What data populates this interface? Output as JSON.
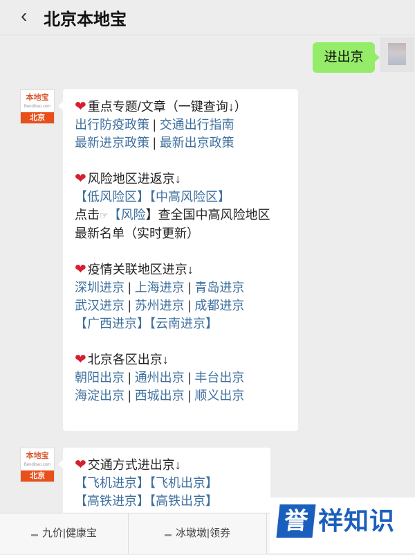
{
  "header": {
    "back_icon": "chevron-left-icon",
    "title": "北京本地宝"
  },
  "outgoing": {
    "text": "进出京"
  },
  "bot": {
    "logo_top": "本地宝",
    "logo_sub": "Bendibao.com",
    "logo_city": "北京"
  },
  "message1": {
    "section1_title": "重点专题/文章（一键查询↓）",
    "section1_row1": [
      "出行防疫政策",
      " | ",
      "交通出行指南"
    ],
    "section1_row2": [
      "最新进京政策",
      " | ",
      "最新出京政策"
    ],
    "section2_title": "风险地区进返京↓",
    "section2_row1": [
      "【",
      "低风险区",
      "】【",
      "中高风险区",
      "】"
    ],
    "section2_row2": [
      "点击",
      "☞",
      "【",
      "风险",
      "】查全国中高风险地区"
    ],
    "section2_row3": "最新名单（实时更新）",
    "section3_title": "疫情关联地区进京↓",
    "section3_row1": [
      "深圳进京",
      " | ",
      "上海进京",
      " | ",
      "青岛进京"
    ],
    "section3_row2": [
      "武汉进京",
      " | ",
      "苏州进京",
      " | ",
      "成都进京"
    ],
    "section3_row3": [
      "【",
      "广西进京",
      "】【",
      "云南进京",
      "】"
    ],
    "section4_title": "北京各区出京↓",
    "section4_row1": [
      "朝阳出京",
      " | ",
      "通州出京",
      " | ",
      "丰台出京"
    ],
    "section4_row2": [
      "海淀出京",
      " | ",
      "西城出京",
      " | ",
      "顺义出京"
    ]
  },
  "message2": {
    "title": "交通方式进出京↓",
    "row1": [
      "【",
      "飞机进京",
      "】【",
      "飞机出京",
      "】"
    ],
    "row2": [
      "【",
      "高铁进京",
      "】【",
      "高铁出京",
      "】"
    ]
  },
  "bottom_menu": [
    "九价|健康宝",
    "冰墩墩|领券"
  ],
  "watermark": {
    "badge": "誉",
    "text": "祥知识"
  },
  "colors": {
    "link": "#3d6f9e",
    "bubble_out": "#95ec69",
    "heart": "#d61f2f",
    "watermark": "#1a5fbd"
  }
}
